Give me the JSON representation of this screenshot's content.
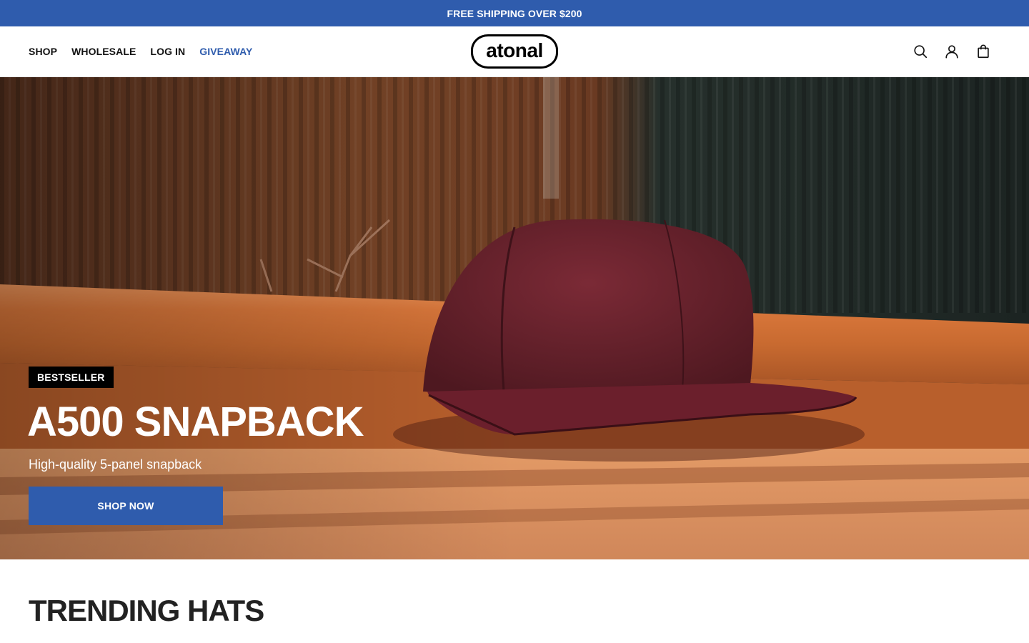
{
  "announcement": {
    "text": "FREE SHIPPING OVER $200"
  },
  "nav": {
    "items": [
      {
        "label": "SHOP"
      },
      {
        "label": "WHOLESALE"
      },
      {
        "label": "LOG IN"
      },
      {
        "label": "GIVEAWAY"
      }
    ]
  },
  "logo": {
    "text": "atonal"
  },
  "header_icons": [
    "search-icon",
    "account-icon",
    "cart-icon"
  ],
  "hero": {
    "badge": "BESTSELLER",
    "title": "A500 SNAPBACK",
    "subtitle": "High-quality 5-panel snapback",
    "cta": "SHOP NOW"
  },
  "section": {
    "title": "TRENDING HATS"
  },
  "colors": {
    "accent": "#2f5cad",
    "badge_bg": "#000000",
    "text": "#111111"
  }
}
